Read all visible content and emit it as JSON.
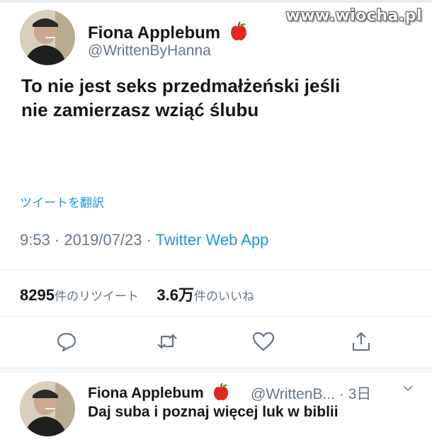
{
  "watermark": "www.wiocha.pl",
  "tweet": {
    "author_name": "Fiona Applebum",
    "author_handle": "@WrittenByHanna",
    "text_line1": "To nie jest seks przedmałżeński jeśli",
    "text_line2": "nie zamierzasz wziąć ślubu",
    "translate_link": "ツイートを翻訳",
    "time": "9:53 · 2019/07/23 · ",
    "source_app": "Twitter Web App",
    "retweets_count": "8295",
    "retweets_label": "件のリツイート",
    "likes_count": "3.6万",
    "likes_label": "件のいいね"
  },
  "actions": {
    "reply_icon": "reply-icon",
    "retweet_icon": "retweet-icon",
    "like_icon": "heart-icon",
    "share_icon": "share-icon"
  },
  "reply": {
    "author_name": "Fiona Applebum",
    "author_handle": "@WrittenB... · 3日",
    "text": "Daj suba i poznaj więcej luk w biblii"
  },
  "colors": {
    "link": "#1b95e0",
    "secondary_text": "#657786",
    "divider": "#e6ecf0",
    "apple_red": "#e0281f"
  }
}
